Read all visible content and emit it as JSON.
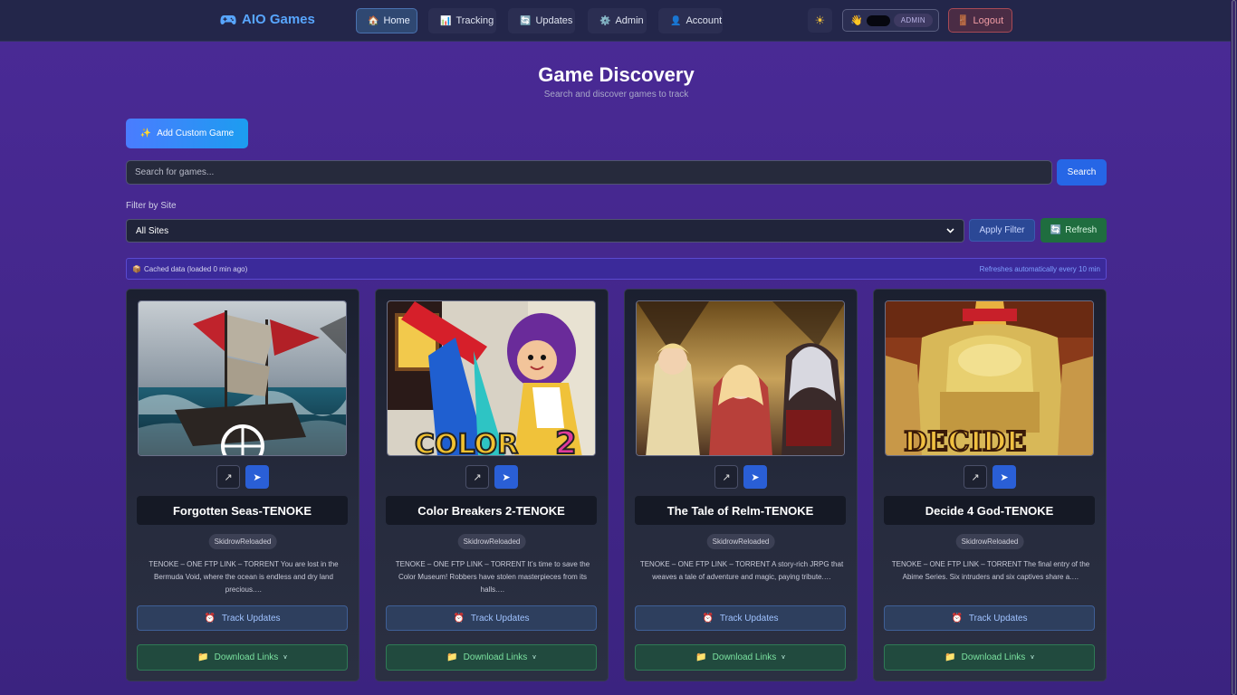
{
  "nav": {
    "brand": "AIO Games",
    "brand_icon": "gamepad-icon",
    "items": [
      {
        "label": "Home",
        "icon": "🏠"
      },
      {
        "label": "Tracking",
        "icon": "📊"
      },
      {
        "label": "Updates",
        "icon": "🔄"
      },
      {
        "label": "Admin",
        "icon": "⚙️"
      },
      {
        "label": "Account",
        "icon": "👤"
      }
    ],
    "active": "Home",
    "theme_icon": "☀",
    "user_wave": "👋",
    "role_badge": "ADMIN",
    "logout_icon": "🚪",
    "logout_label": "Logout"
  },
  "header": {
    "title": "Game Discovery",
    "subtitle": "Search and discover games to track"
  },
  "actions": {
    "add_icon": "✨",
    "add_label": "Add Custom Game",
    "search_placeholder": "Search for games...",
    "search_label": "Search",
    "filter_label": "Filter by Site",
    "filter_selected": "All Sites",
    "apply_label": "Apply Filter",
    "refresh_icon": "🔄",
    "refresh_label": "Refresh"
  },
  "cache": {
    "icon": "📦",
    "status": "Cached data (loaded 0 min ago)",
    "auto_refresh": "Refreshes automatically every 10 min"
  },
  "cards": [
    {
      "title": "Forgotten Seas-TENOKE",
      "source": "SkidrowReloaded",
      "description": "TENOKE – ONE FTP LINK – TORRENT You are lost in the Bermuda Void, where the ocean is endless and dry land precious.…",
      "track_label": "Track Updates",
      "download_label": "Download Links"
    },
    {
      "title": "Color Breakers 2-TENOKE",
      "source": "SkidrowReloaded",
      "description": "TENOKE – ONE FTP LINK – TORRENT It’s time to save the Color Museum! Robbers have stolen masterpieces from its halls.…",
      "track_label": "Track Updates",
      "download_label": "Download Links"
    },
    {
      "title": "The Tale of Relm-TENOKE",
      "source": "SkidrowReloaded",
      "description": "TENOKE – ONE FTP LINK – TORRENT A story-rich JRPG that weaves a tale of adventure and magic, paying tribute.…",
      "track_label": "Track Updates",
      "download_label": "Download Links"
    },
    {
      "title": "Decide 4 God-TENOKE",
      "source": "SkidrowReloaded",
      "description": "TENOKE – ONE FTP LINK – TORRENT The final entry of the Abime Series. Six intruders and six captives share a.…",
      "track_label": "Track Updates",
      "download_label": "Download Links"
    }
  ],
  "card_icons": {
    "external": "↗",
    "telegram": "➤",
    "clock": "⏰",
    "folder": "📁",
    "caret": "v"
  }
}
